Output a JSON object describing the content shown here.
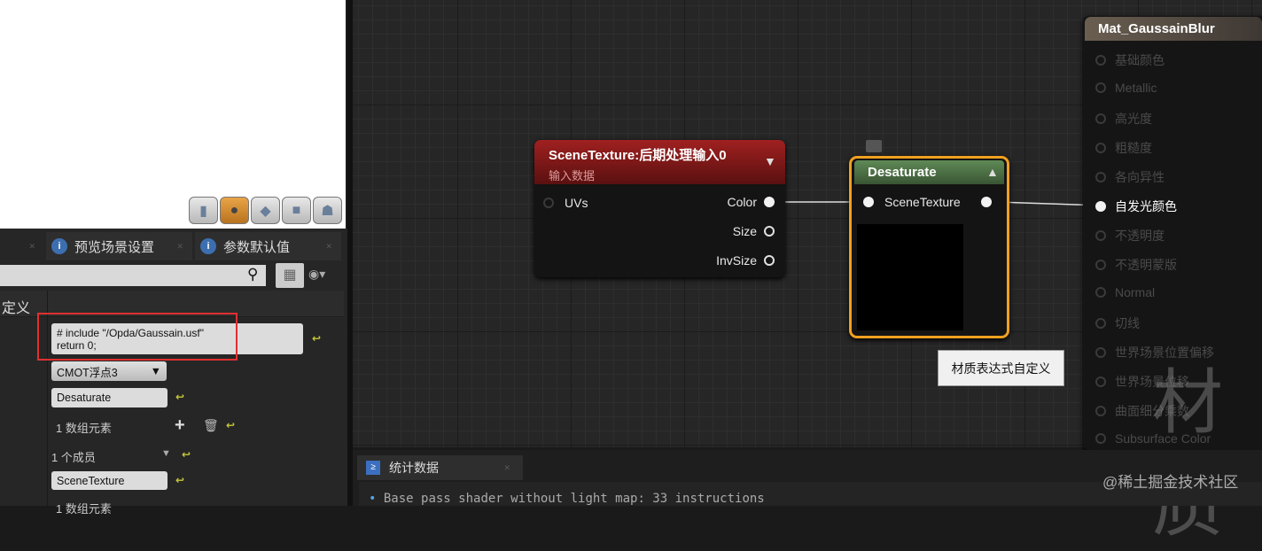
{
  "preview": {
    "buttons": [
      {
        "icon": "cylinder-icon"
      },
      {
        "icon": "sphere-icon",
        "active": true
      },
      {
        "icon": "plane-icon"
      },
      {
        "icon": "cube-icon"
      },
      {
        "icon": "teapot-icon"
      }
    ]
  },
  "left_panel": {
    "tabs": [
      {
        "label": "预览场景设置"
      },
      {
        "label": "参数默认值"
      }
    ],
    "search_value": "",
    "column_header": "定义",
    "code_value": "# include \"/Opda/Gaussain.usf\"\nreturn 0;",
    "output_type": "CMOT浮点3",
    "description": "Desaturate",
    "inputs_count": "1 数组元素",
    "members": "1 个成员",
    "input_name": "SceneTexture",
    "next_count": "1 数组元素"
  },
  "graph": {
    "scene_texture_node": {
      "title": "SceneTexture:后期处理输入0",
      "subtitle": "输入数据",
      "inputs": [
        "UVs"
      ],
      "outputs": [
        "Color",
        "Size",
        "InvSize"
      ]
    },
    "desaturate_node": {
      "title": "Desaturate",
      "input": "SceneTexture"
    },
    "tooltip": "材质表达式自定义",
    "material_node": {
      "title": "Mat_GaussainBlur",
      "pins": [
        "基础颜色",
        "Metallic",
        "高光度",
        "粗糙度",
        "各向异性",
        "自发光颜色",
        "不透明度",
        "不透明蒙版",
        "Normal",
        "切线",
        "世界场景位置偏移",
        "世界场景位移",
        "曲面细分乘数",
        "Subsurface Color"
      ],
      "active_pin": "自发光颜色"
    },
    "watermark": "材质"
  },
  "stats": {
    "tab": "统计数据",
    "line": "Base pass shader without light map: 33 instructions"
  },
  "site_watermark": "@稀土掘金技术社区",
  "colors": {
    "selection": "#f0a020",
    "scene_header": "#8b1a1a",
    "desaturate_header": "#4f7048",
    "highlight_box": "#e03030"
  }
}
